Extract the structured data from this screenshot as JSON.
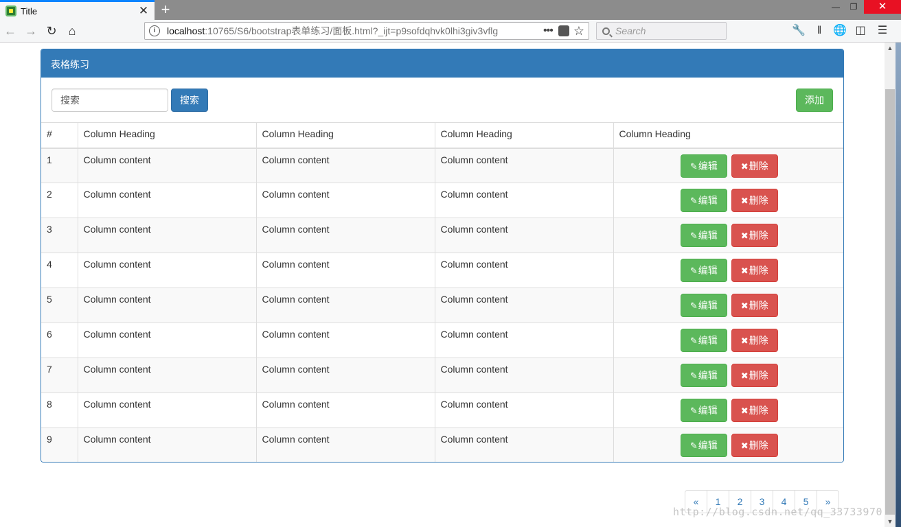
{
  "browser": {
    "tab_title": "Title",
    "tab_close": "✕",
    "new_tab": "+",
    "url_host": "localhost",
    "url_rest": ":10765/S6/bootstrap表单练习/面板.html?_ijt=p9sofdqhvk0lhi3giv3vflg",
    "url_more": "•••",
    "search_placeholder": "Search"
  },
  "panel": {
    "title": "表格练习",
    "search_value": "搜索",
    "search_button": "搜索",
    "add_button": "添加"
  },
  "table": {
    "headers": [
      "#",
      "Column Heading",
      "Column Heading",
      "Column Heading",
      "Column Heading"
    ],
    "edit_label": "编辑",
    "delete_label": "删除",
    "rows": [
      [
        "1",
        "Column content",
        "Column content",
        "Column content"
      ],
      [
        "2",
        "Column content",
        "Column content",
        "Column content"
      ],
      [
        "3",
        "Column content",
        "Column content",
        "Column content"
      ],
      [
        "4",
        "Column content",
        "Column content",
        "Column content"
      ],
      [
        "5",
        "Column content",
        "Column content",
        "Column content"
      ],
      [
        "6",
        "Column content",
        "Column content",
        "Column content"
      ],
      [
        "7",
        "Column content",
        "Column content",
        "Column content"
      ],
      [
        "8",
        "Column content",
        "Column content",
        "Column content"
      ],
      [
        "9",
        "Column content",
        "Column content",
        "Column content"
      ]
    ]
  },
  "pagination": [
    "«",
    "1",
    "2",
    "3",
    "4",
    "5",
    "»"
  ],
  "watermark": "http://blog.csdn.net/qq_33733970",
  "colors": {
    "primary": "#337ab7",
    "success": "#5cb85c",
    "danger": "#d9534f"
  }
}
